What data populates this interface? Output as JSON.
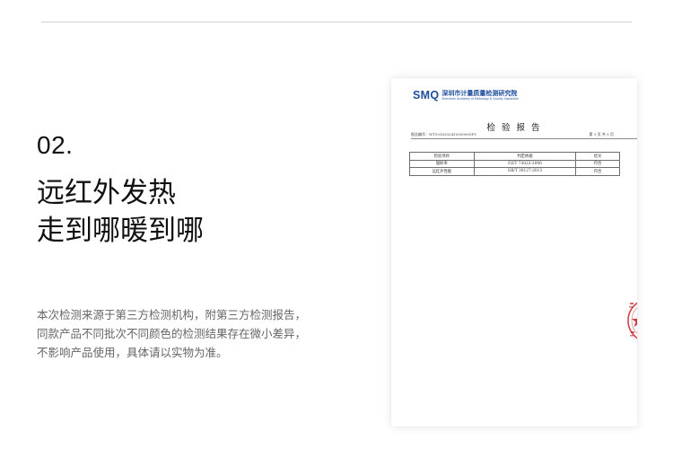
{
  "section": {
    "number": "02."
  },
  "headline": {
    "line1": "远红外发热",
    "line2": "走到哪暖到哪"
  },
  "description": {
    "line1": "本次检测来源于第三方检测机构，附第三方检测报告，",
    "line2": "同款产品不同批次不同颜色的检测结果存在微小差异，",
    "line3": "不影响产品使用，具体请以实物为准。"
  },
  "report": {
    "logo": "SMQ",
    "org_name": "深圳市计量质量检测研究院",
    "org_name_en": "Shenzhen Academy of Metrology & Quality Inspection",
    "title": "检 验 报 告",
    "report_no": "报告编号：WT1018332410590000F1",
    "page_info": "第 3 页 共 5 页",
    "table": {
      "headers": [
        "检验项目",
        "判定依据",
        "结论"
      ],
      "rows": [
        [
          "辐射率",
          "FZ/T 73023-2006",
          "符合"
        ],
        [
          "远红外性能",
          "GB/T 30127-2013",
          "符合"
        ]
      ]
    }
  },
  "colors": {
    "brand_blue": "#1f4e9a",
    "seal_red": "#c8232c",
    "rule_gray": "#d2d2d2"
  }
}
